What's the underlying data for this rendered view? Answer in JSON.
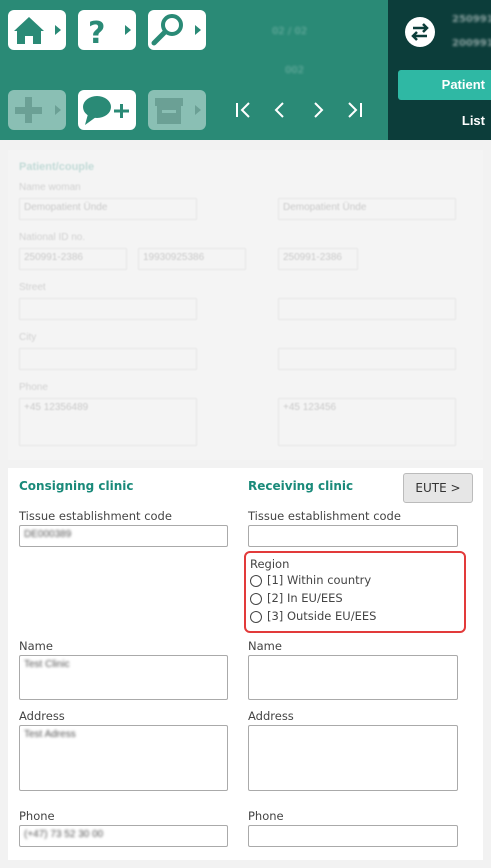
{
  "toolbar": {
    "blur_top": "02 / 02",
    "blur_mid": "002"
  },
  "header": {
    "patient_id_1": "250991",
    "patient_id_2": "200991",
    "tab_patient": "Patient",
    "tab_list": "List"
  },
  "patient": {
    "title": "Patient/couple",
    "name_label": "Name woman",
    "name_value": "Demopatient Ünde",
    "nid_label": "National ID no.",
    "nid_value_1": "250991-2386",
    "nid_value_2": "19930925386",
    "street_label": "Street",
    "city_label": "City",
    "phone_label": "Phone",
    "phone_value": "+45 12356489",
    "partner_name": "Demopatient Ünde",
    "partner_nid": "250991-2386",
    "partner_phone": "+45 123456"
  },
  "clinic": {
    "consigning_title": "Consigning clinic",
    "receiving_title": "Receiving clinic",
    "eute_button": "EUTE >",
    "tissue_label_left": "Tissue establishment code",
    "tissue_value_left": "DE000389",
    "tissue_label_right": "Tissue establishment code",
    "region_label": "Region",
    "region_options": [
      "[1] Within country",
      "[2] In EU/EES",
      "[3] Outside EU/EES"
    ],
    "name_label_left": "Name",
    "name_value_left": "Test Clinic",
    "name_label_right": "Name",
    "address_label_left": "Address",
    "address_value_left": "Test Adress",
    "address_label_right": "Address",
    "phone_label_left": "Phone",
    "phone_value_left": "(+47) 73 52 30 00",
    "phone_label_right": "Phone"
  },
  "colors": {
    "toolbar": "#2a8a76",
    "panel": "#0c3d3a",
    "accent": "#2fb8a4",
    "highlight": "#e23a3a"
  }
}
